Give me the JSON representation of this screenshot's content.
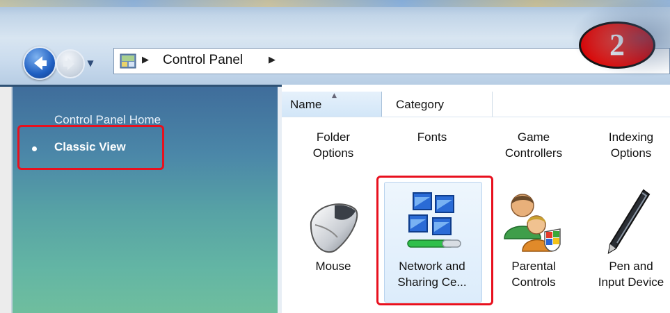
{
  "address_bar": {
    "path": "Control Panel"
  },
  "step_badge": {
    "number": "2"
  },
  "sidebar": {
    "home_link": "Control Panel Home",
    "classic_view": "Classic View"
  },
  "columns": {
    "name": "Name",
    "category": "Category"
  },
  "top_row": [
    {
      "line1": "Folder",
      "line2": "Options"
    },
    {
      "line1": "Fonts",
      "line2": ""
    },
    {
      "line1": "Game",
      "line2": "Controllers"
    },
    {
      "line1": "Indexing",
      "line2": "Options"
    }
  ],
  "icon_row": [
    {
      "line1": "Mouse",
      "line2": "",
      "icon": "mouse-icon"
    },
    {
      "line1": "Network and",
      "line2": "Sharing Ce...",
      "icon": "network-sharing-icon"
    },
    {
      "line1": "Parental",
      "line2": "Controls",
      "icon": "parental-controls-icon"
    },
    {
      "line1": "Pen and",
      "line2": "Input Device",
      "icon": "pen-input-icon"
    }
  ],
  "colors": {
    "highlight": "#e8101e",
    "badge": "#dd0000"
  }
}
